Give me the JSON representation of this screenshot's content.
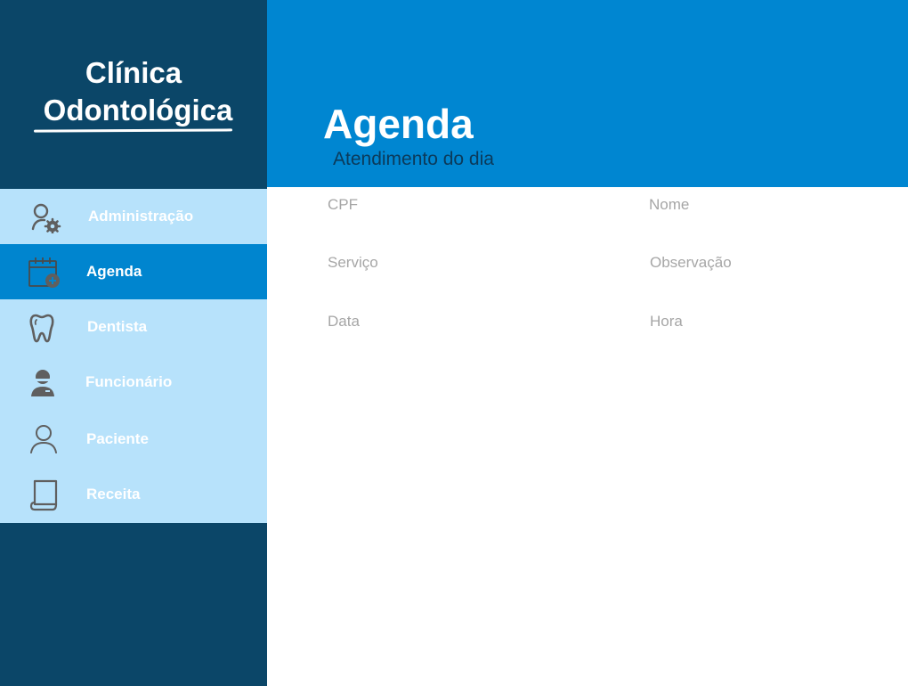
{
  "brand": {
    "line1": "Clínica",
    "line2": "Odontológica"
  },
  "sidebar": {
    "items": [
      {
        "label": "Administração",
        "icon": "admin-gear-icon",
        "active": false
      },
      {
        "label": "Agenda",
        "icon": "calendar-add-icon",
        "active": true
      },
      {
        "label": "Dentista",
        "icon": "tooth-icon",
        "active": false
      },
      {
        "label": "Funcionário",
        "icon": "employee-icon",
        "active": false
      },
      {
        "label": "Paciente",
        "icon": "user-icon",
        "active": false
      },
      {
        "label": "Receita",
        "icon": "scroll-icon",
        "active": false
      }
    ]
  },
  "header": {
    "title": "Agenda",
    "subtitle": "Atendimento do dia"
  },
  "form": {
    "fields": [
      {
        "label": "CPF"
      },
      {
        "label": "Nome"
      },
      {
        "label": "Serviço"
      },
      {
        "label": "Observação"
      },
      {
        "label": "Data"
      },
      {
        "label": "Hora"
      }
    ]
  },
  "colors": {
    "sidebar_dark": "#0b4668",
    "nav_light": "#b7e2fb",
    "accent": "#0086d1",
    "subtitle": "#0b3a5a",
    "field_label": "#a6a6a6",
    "icon": "#5f5f5f"
  }
}
